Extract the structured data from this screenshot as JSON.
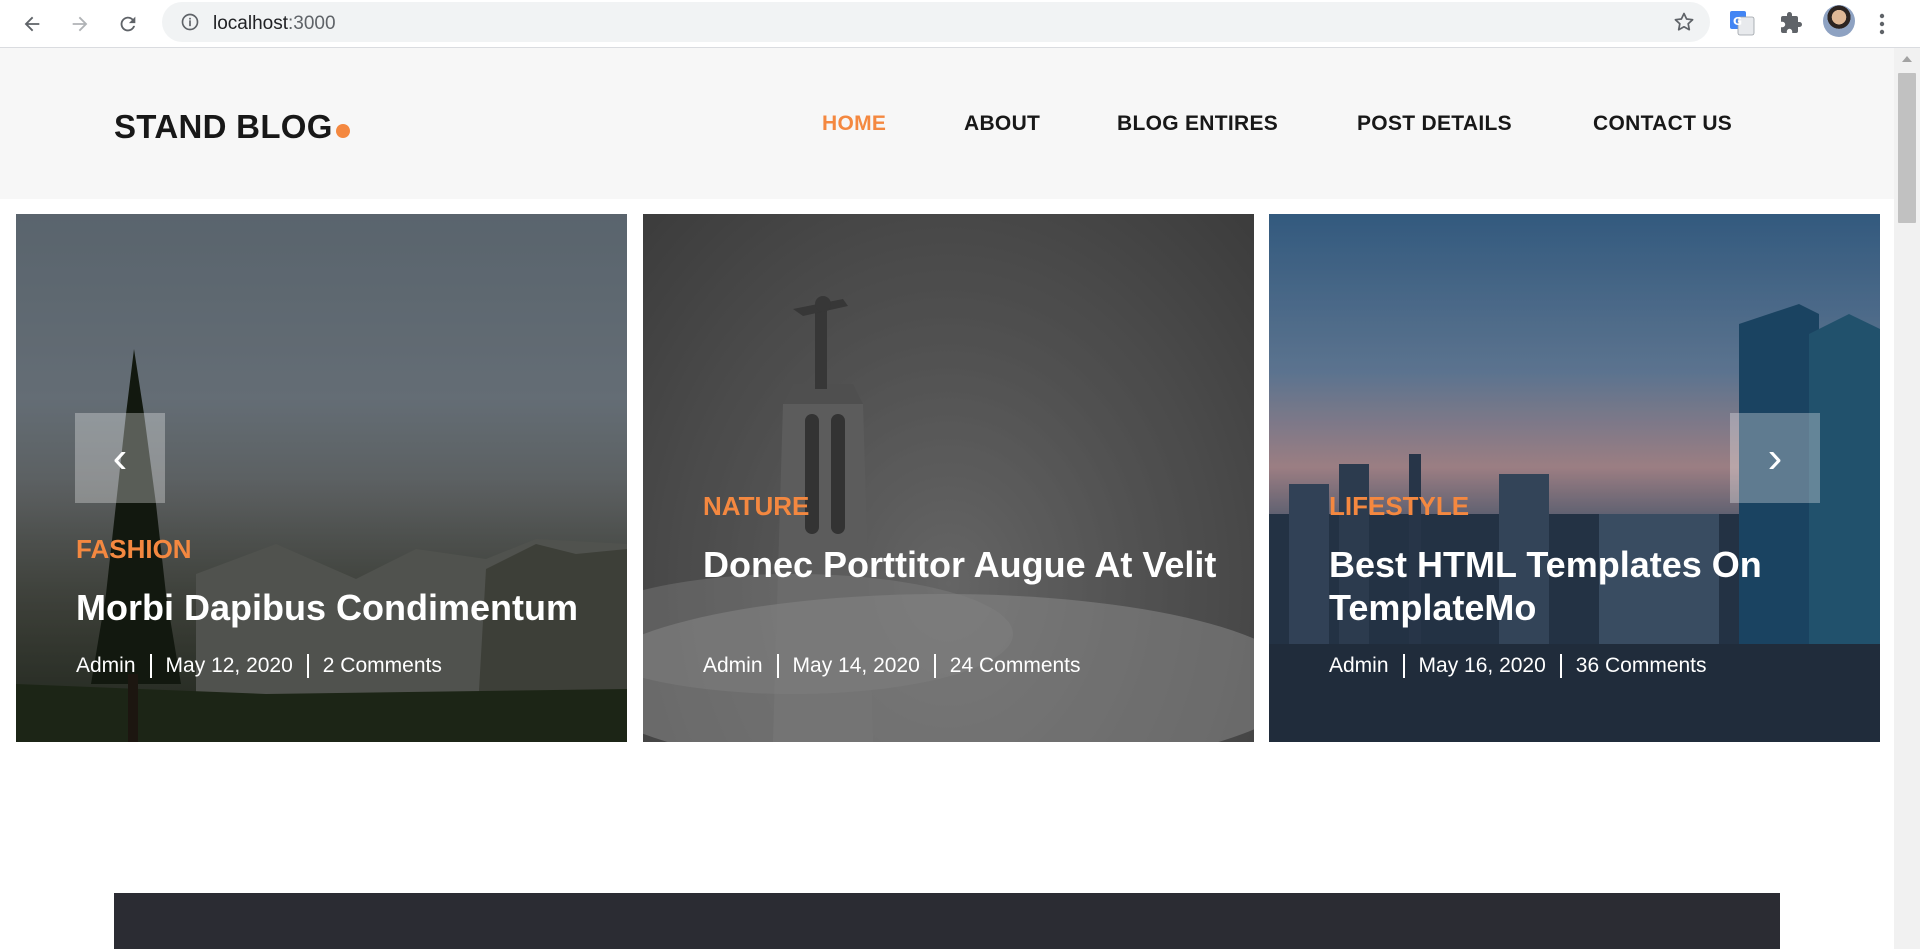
{
  "browser": {
    "url_host": "localhost",
    "url_port": ":3000",
    "icons": [
      "back-icon",
      "forward-icon",
      "reload-icon",
      "info-icon",
      "star-icon",
      "google-translate-icon",
      "puzzle-icon",
      "avatar",
      "kebab-menu-icon"
    ]
  },
  "site": {
    "logo_text": "STAND BLOG",
    "accent_color": "#f48840",
    "nav": [
      {
        "label": "HOME",
        "active": true
      },
      {
        "label": "ABOUT",
        "active": false
      },
      {
        "label": "BLOG ENTIRES",
        "active": false
      },
      {
        "label": "POST DETAILS",
        "active": false
      },
      {
        "label": "CONTACT US",
        "active": false
      }
    ]
  },
  "slider": {
    "prev_label": "‹",
    "next_label": "›",
    "slides": [
      {
        "category": "FASHION",
        "title": "Morbi Dapibus Condimentum",
        "author": "Admin",
        "date": "May 12, 2020",
        "comments": "2 Comments"
      },
      {
        "category": "NATURE",
        "title": "Donec Porttitor Augue At Velit",
        "author": "Admin",
        "date": "May 14, 2020",
        "comments": "24 Comments"
      },
      {
        "category": "LIFESTYLE",
        "title": "Best HTML Templates On TemplateMo",
        "author": "Admin",
        "date": "May 16, 2020",
        "comments": "36 Comments"
      }
    ]
  }
}
